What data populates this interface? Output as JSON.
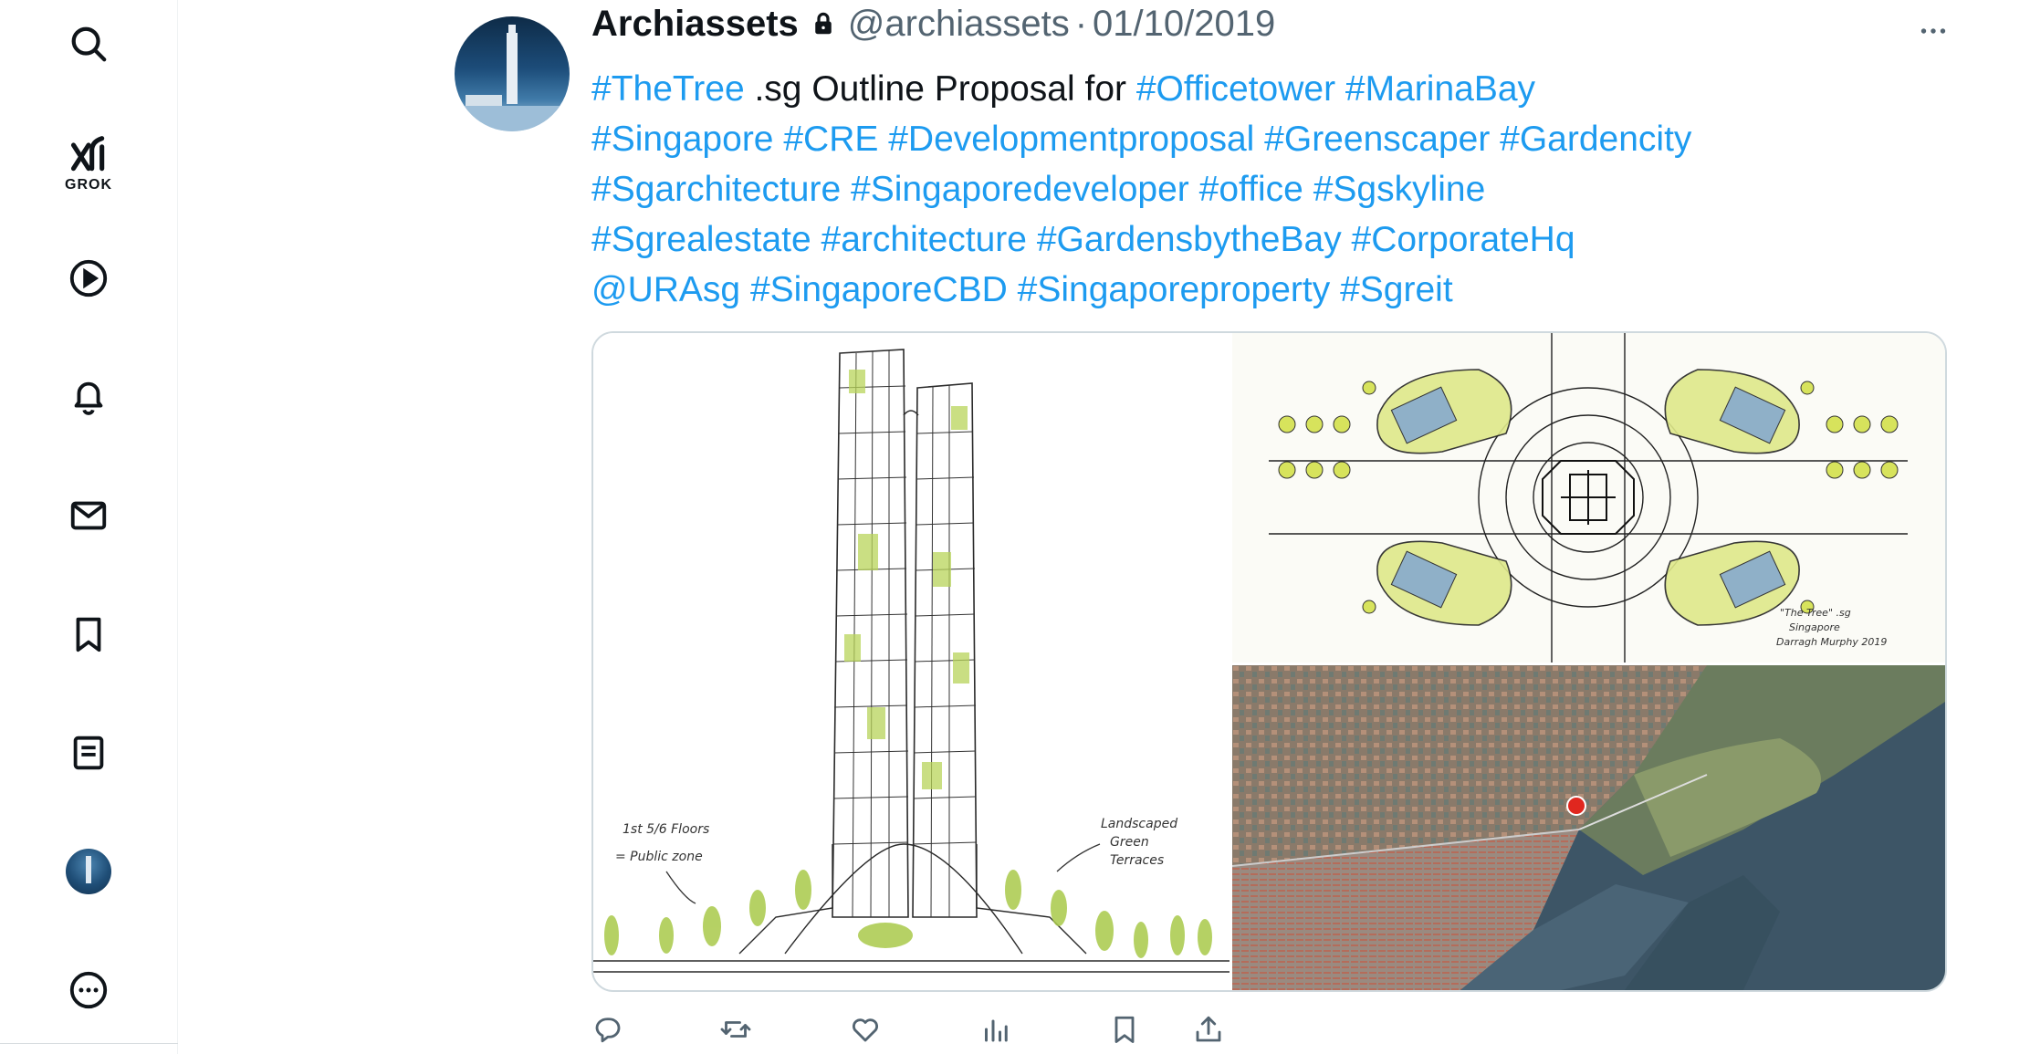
{
  "nav": {
    "items": [
      {
        "name": "search",
        "icon": "search-icon"
      },
      {
        "name": "grok",
        "icon": "grok-icon",
        "label": "GROK"
      },
      {
        "name": "video",
        "icon": "play-icon"
      },
      {
        "name": "notifications",
        "icon": "bell-icon"
      },
      {
        "name": "messages",
        "icon": "mail-icon"
      },
      {
        "name": "bookmarks",
        "icon": "bookmark-icon"
      },
      {
        "name": "lists",
        "icon": "list-icon"
      },
      {
        "name": "profile",
        "icon": "avatar"
      },
      {
        "name": "more",
        "icon": "more-circle-icon"
      }
    ]
  },
  "tweet": {
    "display_name": "Archiassets",
    "handle": "@archiassets",
    "separator": "·",
    "date": "01/10/2019",
    "text_segments": [
      [
        {
          "t": "#TheTree",
          "tag": true
        },
        {
          "t": " .sg Outline Proposal for ",
          "tag": false
        },
        {
          "t": "#Officetower",
          "tag": true
        },
        {
          "t": " ",
          "tag": false
        },
        {
          "t": "#MarinaBay",
          "tag": true
        }
      ],
      [
        {
          "t": "#Singapore",
          "tag": true
        },
        {
          "t": " ",
          "tag": false
        },
        {
          "t": "#CRE",
          "tag": true
        },
        {
          "t": " ",
          "tag": false
        },
        {
          "t": "#Developmentproposal",
          "tag": true
        },
        {
          "t": " ",
          "tag": false
        },
        {
          "t": "#Greenscaper",
          "tag": true
        },
        {
          "t": " ",
          "tag": false
        },
        {
          "t": "#Gardencity",
          "tag": true
        }
      ],
      [
        {
          "t": "#Sgarchitecture",
          "tag": true
        },
        {
          "t": " ",
          "tag": false
        },
        {
          "t": "#Singaporedeveloper",
          "tag": true
        },
        {
          "t": " ",
          "tag": false
        },
        {
          "t": "#office",
          "tag": true
        },
        {
          "t": " ",
          "tag": false
        },
        {
          "t": "#Sgskyline",
          "tag": true
        }
      ],
      [
        {
          "t": "#Sgrealestate",
          "tag": true
        },
        {
          "t": " ",
          "tag": false
        },
        {
          "t": "#architecture",
          "tag": true
        },
        {
          "t": " ",
          "tag": false
        },
        {
          "t": "#GardensbytheBay",
          "tag": true
        },
        {
          "t": " ",
          "tag": false
        },
        {
          "t": "#CorporateHq",
          "tag": true
        }
      ],
      [
        {
          "t": "@URAsg",
          "tag": true
        },
        {
          "t": " ",
          "tag": false
        },
        {
          "t": "#SingaporeCBD",
          "tag": true
        },
        {
          "t": " ",
          "tag": false
        },
        {
          "t": "#Singaporeproperty",
          "tag": true
        },
        {
          "t": " ",
          "tag": false
        },
        {
          "t": "#Sgreit",
          "tag": true
        }
      ]
    ],
    "media": {
      "sketch_notes": {
        "left_note_1": "1st 5/6 Floors",
        "left_note_2": "= Public zone",
        "right_note_1": "Landscaped",
        "right_note_2": "Green",
        "right_note_3": "Terraces"
      },
      "plan_caption": {
        "line1": "\"The Tree\" .sg",
        "line2": "Singapore",
        "line3": "Darragh Murphy 2019"
      }
    },
    "actions": [
      {
        "name": "reply",
        "icon": "reply-icon"
      },
      {
        "name": "retweet",
        "icon": "retweet-icon"
      },
      {
        "name": "like",
        "icon": "heart-icon"
      },
      {
        "name": "views",
        "icon": "analytics-icon"
      },
      {
        "name": "bookmark",
        "icon": "bookmark-icon"
      },
      {
        "name": "share",
        "icon": "share-icon"
      }
    ]
  },
  "colors": {
    "link": "#1d9bf0",
    "text": "#0f1419",
    "muted": "#536471",
    "border": "#cfd9de",
    "map_pin": "#e0271f"
  }
}
